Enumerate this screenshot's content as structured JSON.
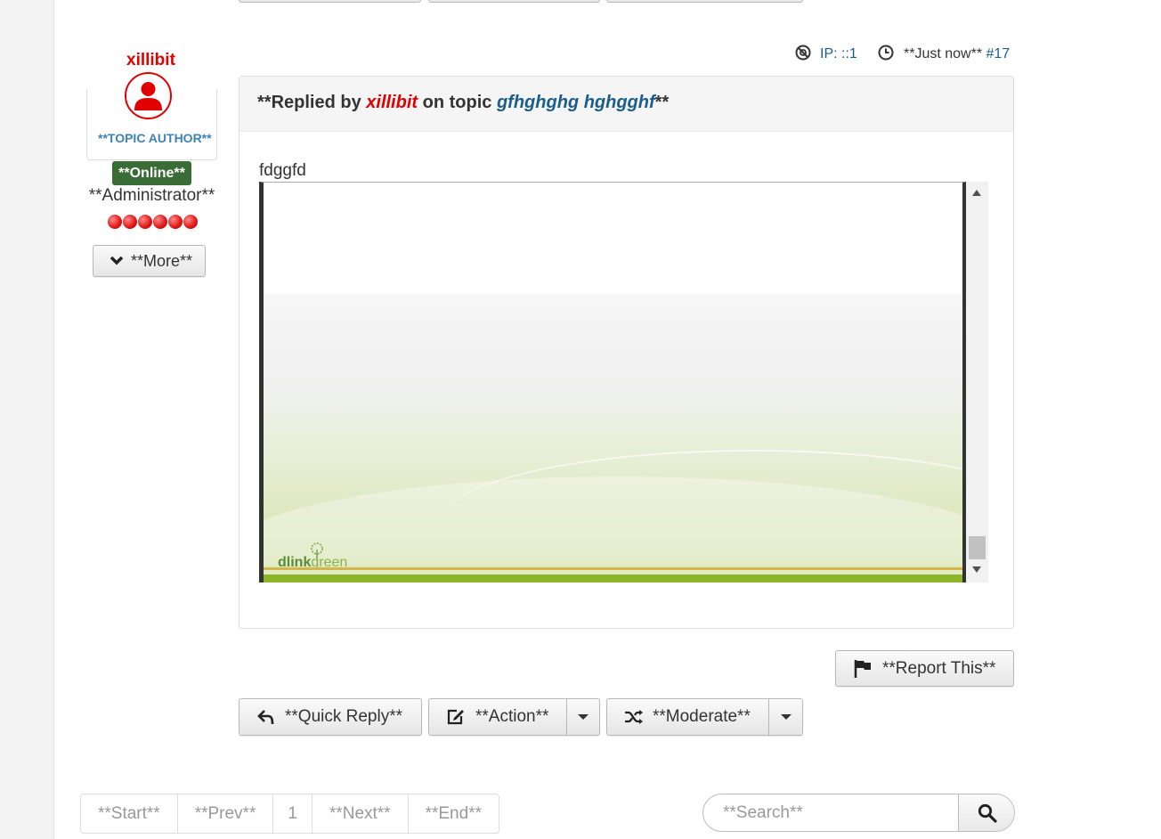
{
  "author": {
    "name": "xillibit",
    "badge": "**TOPIC AUTHOR**",
    "status": "**Online**",
    "role": "**Administrator**",
    "rank_stars": 6,
    "more_label": "**More**"
  },
  "meta": {
    "ip_label": "IP: ::1",
    "time_label": "**Just now**",
    "post_number": "#17"
  },
  "message": {
    "title_prefix": "**Replied by ",
    "title_user": "xillibit",
    "title_mid": " on topic ",
    "title_topic": "gfhghghg hghgghf",
    "title_suffix": "**",
    "body": "fdggfd",
    "embed_brand_a": "dlink",
    "embed_brand_b": "green"
  },
  "actions": {
    "report": "**Report This**",
    "quick_reply": "**Quick Reply**",
    "action": "**Action**",
    "moderate": "**Moderate**"
  },
  "pagination": {
    "start": "**Start**",
    "prev": "**Prev**",
    "page": "1",
    "next": "**Next**",
    "end": "**End**"
  },
  "search": {
    "placeholder": "**Search**"
  },
  "colors": {
    "author_red": "#e00000",
    "link_blue": "#1a5d8c",
    "online_green": "#3a6d35"
  }
}
